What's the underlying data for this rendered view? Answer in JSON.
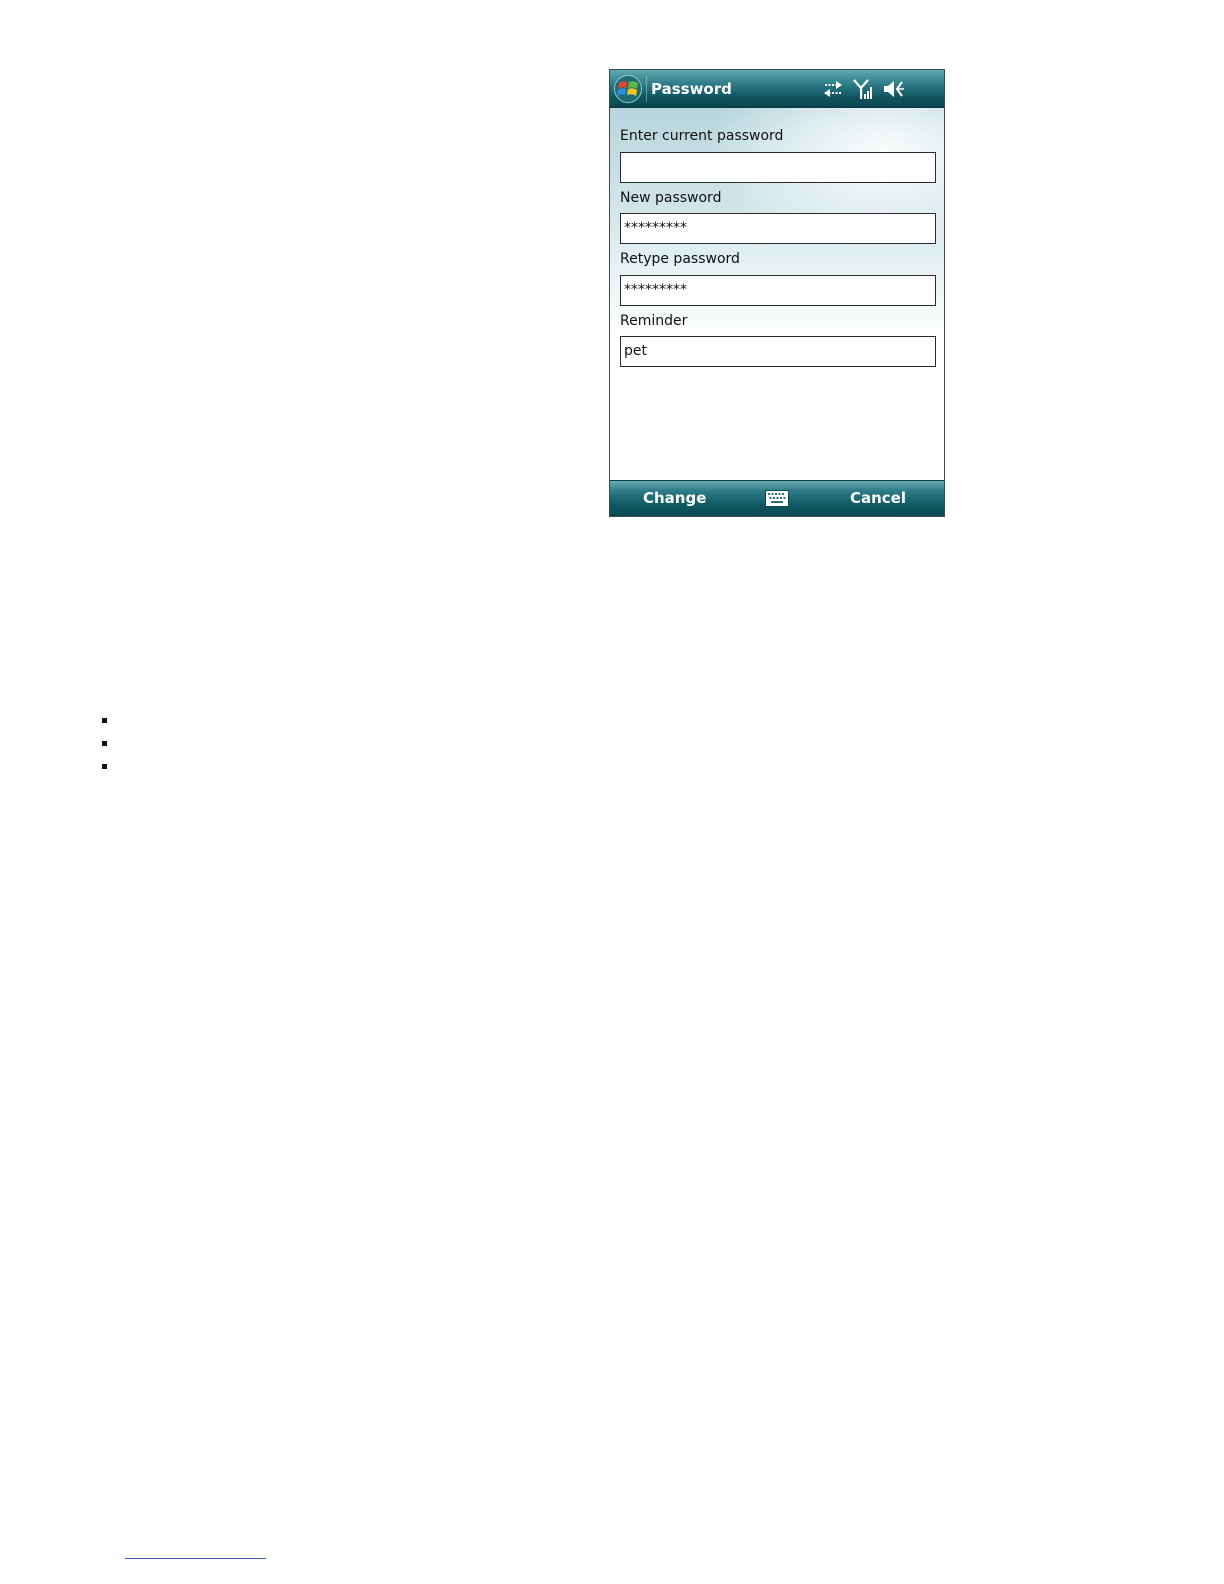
{
  "window": {
    "title": "Password",
    "start_icon": "windows-flag-icon"
  },
  "status_icons": [
    "sync-arrows-icon",
    "signal-strength-icon",
    "speaker-muted-icon"
  ],
  "fields": [
    {
      "label": "Enter current password",
      "value": ""
    },
    {
      "label": "New password",
      "value": "*********"
    },
    {
      "label": "Retype password",
      "value": "*********"
    },
    {
      "label": "Reminder",
      "value": "pet"
    }
  ],
  "softkeys": {
    "left": "Change",
    "center_icon": "keyboard-icon",
    "right": "Cancel"
  },
  "colors": {
    "title_bar": "#0f5661",
    "soft_bar": "#0e5862",
    "footnote_rule": "#3b5cb8"
  }
}
